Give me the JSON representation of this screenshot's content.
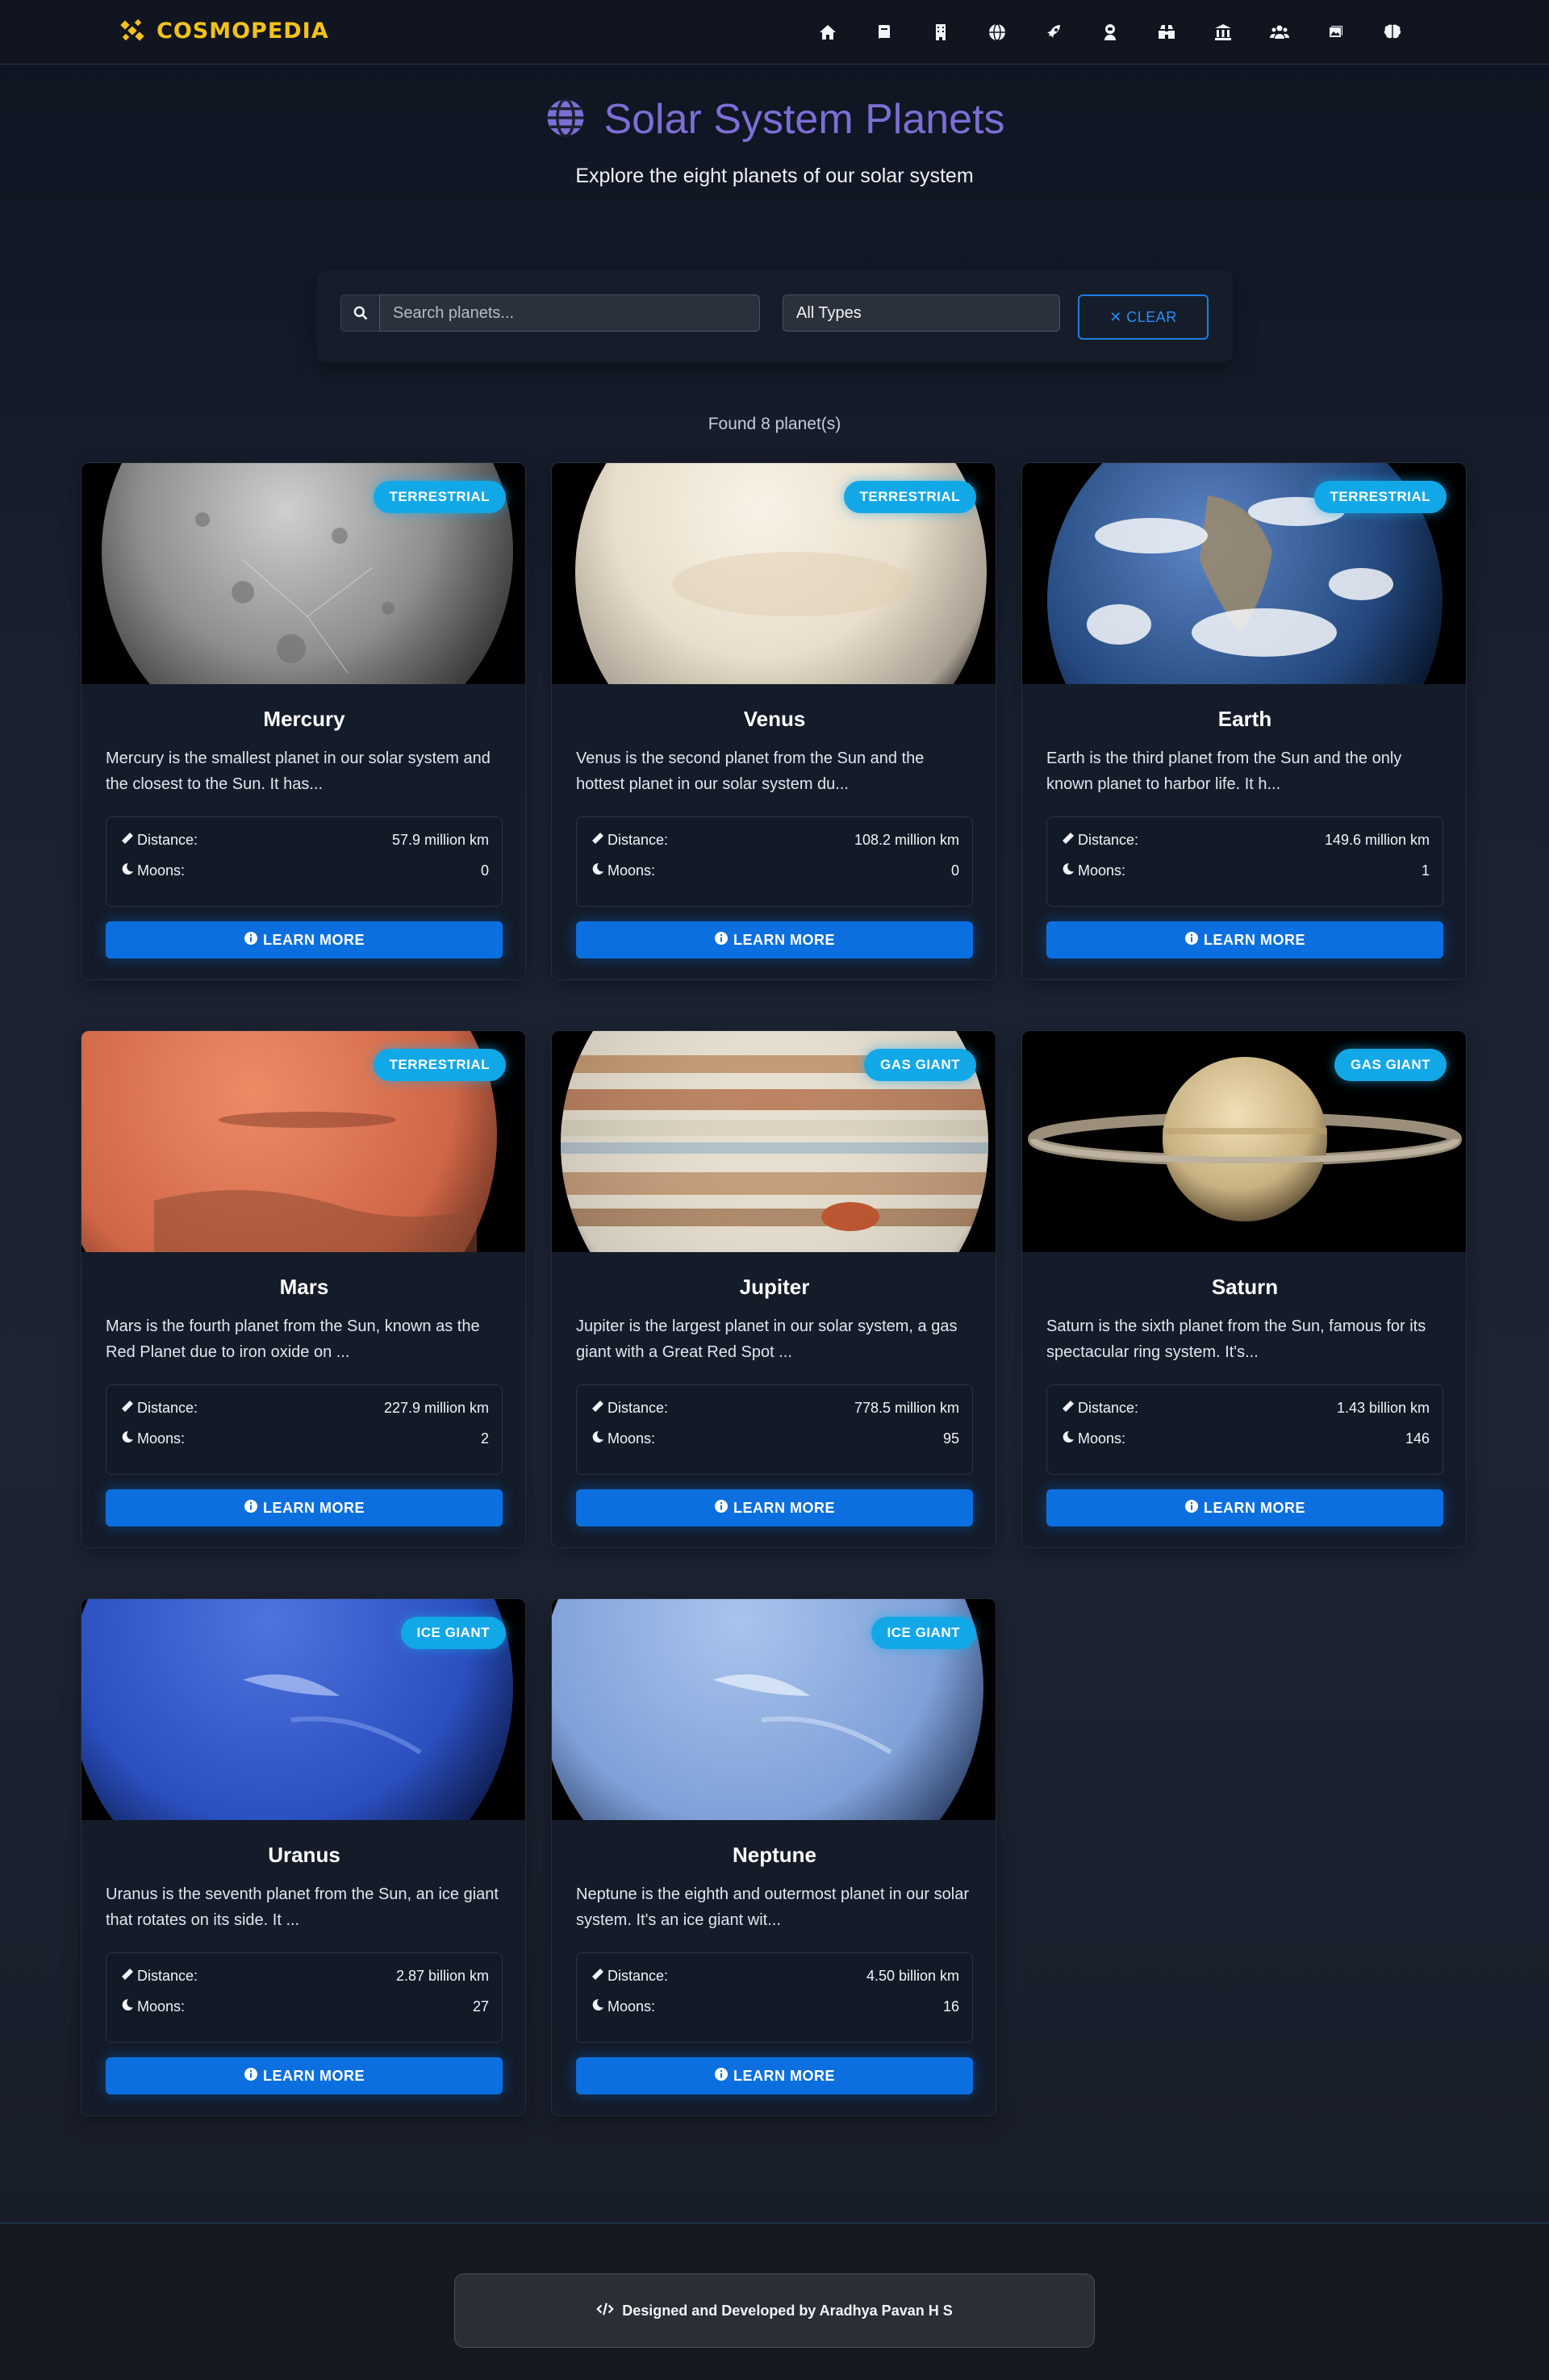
{
  "nav": {
    "brand": "COSMOPEDIA",
    "icons": [
      "home-icon",
      "book-icon",
      "building-icon",
      "globe-icon",
      "rocket-icon",
      "astronaut-icon",
      "binoculars-icon",
      "museum-icon",
      "users-icon",
      "gallery-icon",
      "brain-icon"
    ]
  },
  "header": {
    "title": "Solar System Planets",
    "subtitle": "Explore the eight planets of our solar system"
  },
  "search": {
    "placeholder": "Search planets...",
    "value": "",
    "type_selected": "All Types",
    "clear_label": "✕ CLEAR"
  },
  "results": {
    "count_text": "Found 8 planet(s)"
  },
  "labels": {
    "distance": "Distance:",
    "moons": "Moons:",
    "learn_more": "LEARN MORE"
  },
  "planets": [
    {
      "name": "Mercury",
      "type": "TERRESTRIAL",
      "description": "Mercury is the smallest planet in our solar system and the closest to the Sun. It has...",
      "distance": "57.9 million km",
      "moons": "0"
    },
    {
      "name": "Venus",
      "type": "TERRESTRIAL",
      "description": "Venus is the second planet from the Sun and the hottest planet in our solar system du...",
      "distance": "108.2 million km",
      "moons": "0"
    },
    {
      "name": "Earth",
      "type": "TERRESTRIAL",
      "description": "Earth is the third planet from the Sun and the only known planet to harbor life. It h...",
      "distance": "149.6 million km",
      "moons": "1"
    },
    {
      "name": "Mars",
      "type": "TERRESTRIAL",
      "description": "Mars is the fourth planet from the Sun, known as the Red Planet due to iron oxide on ...",
      "distance": "227.9 million km",
      "moons": "2"
    },
    {
      "name": "Jupiter",
      "type": "GAS GIANT",
      "description": "Jupiter is the largest planet in our solar system, a gas giant with a Great Red Spot ...",
      "distance": "778.5 million km",
      "moons": "95"
    },
    {
      "name": "Saturn",
      "type": "GAS GIANT",
      "description": "Saturn is the sixth planet from the Sun, famous for its spectacular ring system. It's...",
      "distance": "1.43 billion km",
      "moons": "146"
    },
    {
      "name": "Uranus",
      "type": "ICE GIANT",
      "description": "Uranus is the seventh planet from the Sun, an ice giant that rotates on its side. It ...",
      "distance": "2.87 billion km",
      "moons": "27"
    },
    {
      "name": "Neptune",
      "type": "ICE GIANT",
      "description": "Neptune is the eighth and outermost planet in our solar system. It's an ice giant wit...",
      "distance": "4.50 billion km",
      "moons": "16"
    }
  ],
  "footer": {
    "credit": "Designed and Developed by Aradhya Pavan H S"
  },
  "colors": {
    "brand": "#f2c21b",
    "title": "#7b6fd6",
    "accent": "#0b6fe0",
    "badge": "#12a8e8"
  }
}
